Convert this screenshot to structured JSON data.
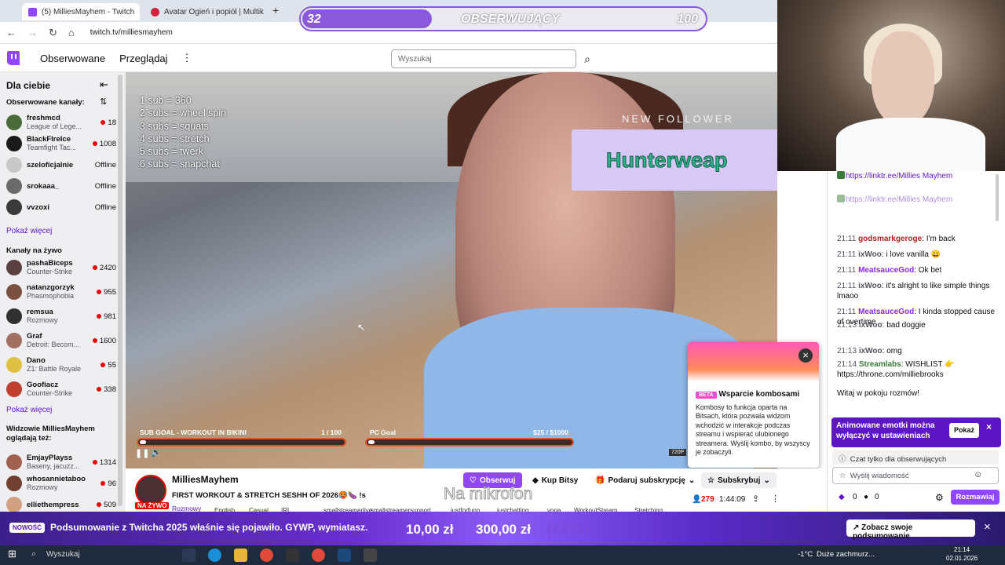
{
  "browser": {
    "tabs": [
      {
        "label": "(5) MilliesMayhem - Twitch"
      },
      {
        "label": "Avatar Ogień i popiół | Multikin"
      }
    ],
    "new_tab": "+",
    "url": "twitch.tv/milliesmayhem"
  },
  "header": {
    "nav": [
      "Obserwowane",
      "Przeglądaj"
    ],
    "more": "⋮",
    "search_placeholder": "Wyszukaj"
  },
  "sidebar": {
    "title": "Dla ciebie",
    "followed_label": "Obserwowane kanały:",
    "followed": [
      {
        "name": "freshmcd",
        "game": "League of Lege...",
        "viewers": "18",
        "color": "#4a6a3a"
      },
      {
        "name": "BlackFIreIce",
        "game": "Teamfight Tac...",
        "viewers": "1008",
        "color": "#1a1a1a"
      },
      {
        "name": "szeloficjalnie",
        "game": "",
        "viewers": "Offline",
        "color": "#c8c8c8"
      },
      {
        "name": "srokaaa_",
        "game": "",
        "viewers": "Offline",
        "color": "#6a6a6a"
      },
      {
        "name": "vvzoxi",
        "game": "",
        "viewers": "Offline",
        "color": "#3a3a3a"
      }
    ],
    "show_more_1": "Pokaż więcej",
    "live_label": "Kanały na żywo",
    "live": [
      {
        "name": "pashaBiceps",
        "game": "Counter-Strike",
        "viewers": "2420",
        "color": "#5a4040"
      },
      {
        "name": "natanzgorzyk",
        "game": "Phasmophobia",
        "viewers": "955",
        "color": "#7a5040"
      },
      {
        "name": "remsua",
        "game": "Rozmowy",
        "viewers": "981",
        "color": "#303030"
      },
      {
        "name": "Graf",
        "game": "Detroit: Becom...",
        "viewers": "1600",
        "color": "#a07060"
      },
      {
        "name": "Dano",
        "game": "Z1: Battle Royale",
        "viewers": "55",
        "color": "#e0c040"
      },
      {
        "name": "Goofiacz",
        "game": "Counter-Strike",
        "viewers": "338",
        "color": "#c04030"
      }
    ],
    "show_more_2": "Pokaż więcej",
    "watching_label": "Widzowie MilliesMayhem oglądają też:",
    "watching": [
      {
        "name": "EmjayPlayss",
        "game": "Baseny, jacuzz...",
        "viewers": "1314",
        "color": "#a06050"
      },
      {
        "name": "whosannietaboo",
        "game": "Rozmowy",
        "viewers": "96",
        "color": "#704030"
      },
      {
        "name": "elliethempress",
        "game": "",
        "viewers": "509",
        "color": "#d0a080"
      }
    ]
  },
  "follower_goal": {
    "current": "32",
    "label": "OBSERWUJĄCY",
    "target": "100",
    "progress": 0.32
  },
  "video": {
    "rules": [
      "1 sub = 360",
      "2 subs = wheel spin",
      "3 subs = squats",
      "4 subs = stretch",
      "5 subs = twerk",
      "6 subs = snapchat"
    ],
    "new_follower": "NEW FOLLOWER",
    "follower_name": "Hunterweap",
    "goal1_label": "SUB GOAL - WORKOUT IN BIKINI",
    "goal1_value": "1 / 100",
    "goal1_progress": 0.01,
    "goal2_label": "PC Goal",
    "goal2_value": "$25 / $1000",
    "goal2_progress": 0.025,
    "quality": "720P"
  },
  "combo_popup": {
    "beta": "BETA",
    "title": "Wsparcie kombosami",
    "body": "Kombosy to funkcja oparta na Bitsach, która pozwala widzom wchodzić w interakcje podczas streamu i wspierać ulubionego streamera. Wyślij kombo, by wszyscy je zobaczyli.",
    "close": "×"
  },
  "stream_info": {
    "channel": "MilliesMayhem",
    "title": "FIRST WORKOUT & STRETCH SESHH OF 2026🥵🍆 !s",
    "live": "NA ŻYWO",
    "category": "Rozmowy",
    "tags": [
      "English",
      "Casual",
      "IRL",
      "smallstreamerlive",
      "smallstreamersupport",
      "justforfunn",
      "justchatting",
      "yoga",
      "WorkoutStream",
      "Stretching"
    ],
    "follow": "Obserwuj",
    "bits": "Kup Bitsy",
    "gift": "Podaruj subskrypcję",
    "subscribe": "Subskrybuj",
    "viewers": "279",
    "uptime": "1:44:09",
    "mic_caption": "Na mikrofon"
  },
  "chat": {
    "messages": [
      {
        "time": "",
        "user": "",
        "text": "https://linktr.ee/Millies Mayhem"
      },
      {
        "time": "",
        "user": "",
        "text": "https://linktr.ee/Millies Mayhem"
      },
      {
        "time": "21:11",
        "user": "godsmarkgeroge",
        "text": "I'm back",
        "color": "#b22222"
      },
      {
        "time": "21:11",
        "user": "ixWoo",
        "text": "i love vanilla 😀",
        "color": "#53535f"
      },
      {
        "time": "21:11",
        "user": "MeatsauceGod",
        "text": "Ok bet",
        "color": "#8a2be2"
      },
      {
        "time": "21:11",
        "user": "ixWoo",
        "text": "it's alright to like simple things lmaoo",
        "color": "#53535f"
      },
      {
        "time": "21:11",
        "user": "MeatsauceGod",
        "text": "I kinda stopped cause of overtime",
        "color": "#8a2be2"
      },
      {
        "time": "21:13",
        "user": "ixWoo",
        "text": "bad doggie",
        "color": "#53535f"
      },
      {
        "time": "21:13",
        "user": "ixWoo",
        "text": "omg",
        "color": "#53535f"
      },
      {
        "time": "21:14",
        "user": "Streamlabs",
        "text": "WISHLIST 👉 https://throne.com/milliebrooks",
        "color": "#3a7a3a"
      },
      {
        "time": "",
        "user": "",
        "text": "Witaj w pokoju rozmów!"
      }
    ],
    "anim_notice": "Animowane emotki można wyłączyć w ustawieniach",
    "show": "Pokaż",
    "followers_only": "Czat tylko dla obserwujących",
    "input_placeholder": "Wyślij wiadomość",
    "bits_count": "0",
    "points_count": "0",
    "send": "Rozmawiaj"
  },
  "recap_banner": {
    "badge": "NOWOŚĆ",
    "text": "Podsumowanie z Twitcha 2025 właśnie się pojawiło. GYWP, wymiatasz.",
    "donation": "10,00 zł",
    "donation_goal": "300,00 zł",
    "donation_pct": "(3,33%)",
    "cta": "Zobacz swoje podsumowanie",
    "close": "×"
  },
  "taskbar": {
    "search": "Wyszukaj",
    "weather": "-1°C",
    "weather_text": "Duże zachmurz...",
    "time": "21:14",
    "date": "02.01.2026"
  },
  "colors": {
    "twitch_purple": "#9146ff",
    "accent": "#5c16c5",
    "live_red": "#eb0400"
  }
}
